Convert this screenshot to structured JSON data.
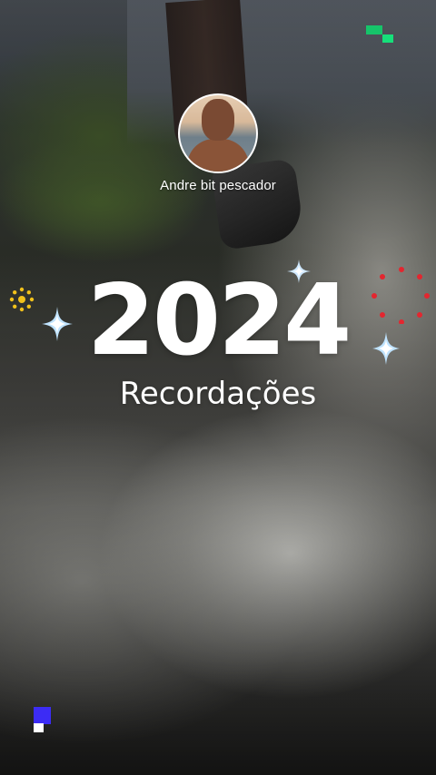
{
  "profile": {
    "name": "Andre bit pescador",
    "avatar_icon": "profile-photo"
  },
  "recap": {
    "year": "2024",
    "subtitle": "Recordações"
  },
  "decorations": {
    "accent_colors": {
      "green": "#16c46a",
      "blue": "#3c2cf5",
      "yellow": "#f2c21b",
      "red": "#e3262f",
      "sparkle": "#bfe3ff"
    },
    "icons": [
      "sparkle-icon",
      "sun-dots-icon",
      "red-dots-circle-icon",
      "pixel-square-icon"
    ]
  }
}
